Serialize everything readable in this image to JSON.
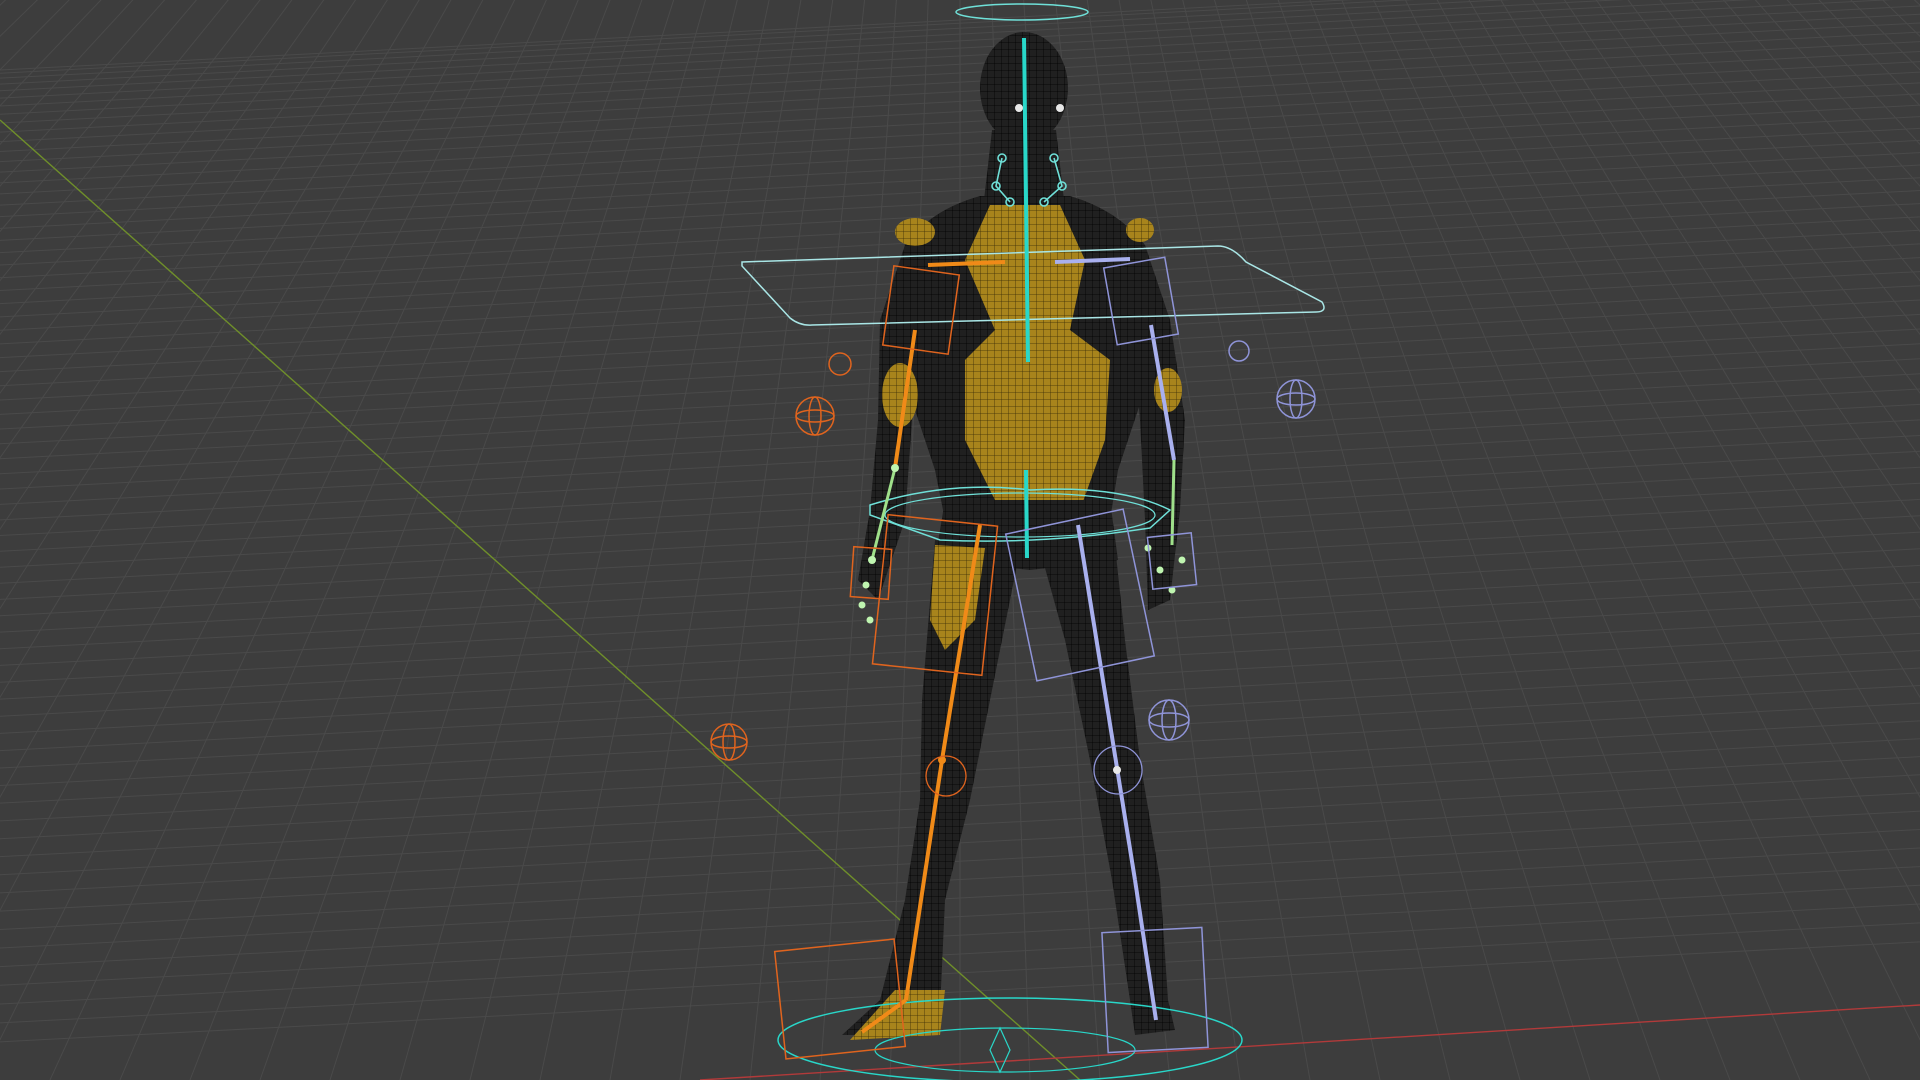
{
  "viewport": {
    "type": "3D viewport",
    "background": "#3d3d3d",
    "grid_color": "#4a4a4a",
    "axis_x_color": "#b23a3a",
    "axis_y_color": "#6f8f2a"
  },
  "mesh": {
    "wire_color": "#1a1a1a",
    "selected_fill": "#a8841c"
  },
  "rig": {
    "spine_color": "#29d7c9",
    "left_chain_color": "#f08a18",
    "right_chain_color": "#a9b0ee",
    "controls_color": "#6fe0d8",
    "left_controls_color": "#e0641e",
    "right_controls_color": "#8f94d8",
    "joint_color": "#bff5b0"
  }
}
